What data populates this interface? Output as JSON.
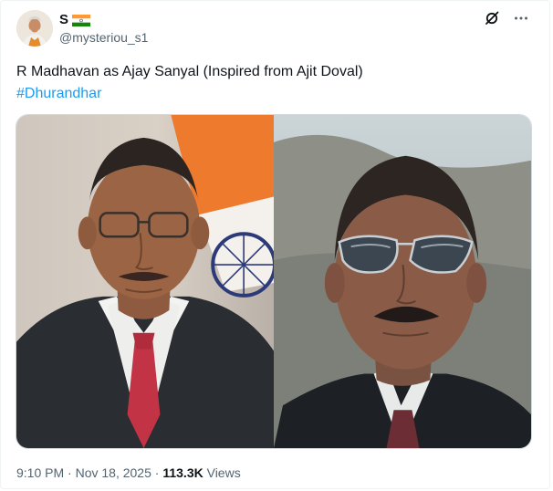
{
  "author": {
    "display_name": "S",
    "handle": "@mysteriou_s1",
    "avatar_icon": "profile-avatar",
    "flag_icon": "india-flag-icon"
  },
  "header_actions": {
    "grok_icon": "slashed-circle-icon",
    "more_icon": "more-horizontal-icon",
    "more_label": "···"
  },
  "tweet": {
    "text": "R Madhavan as Ajay Sanyal (Inspired from Ajit Doval)",
    "hashtag": "#Dhurandhar"
  },
  "media": {
    "left_image": "photo-man-in-suit-with-indian-flag",
    "right_image": "photo-man-in-aviator-sunglasses"
  },
  "meta": {
    "time": "9:10 PM",
    "separator1": " · ",
    "date": "Nov 18, 2025",
    "separator2": " · ",
    "views_count": "113.3K",
    "views_label": " Views"
  },
  "colors": {
    "link": "#1d9bf0",
    "secondary_text": "#536471",
    "primary_text": "#0f1419",
    "border": "#cfd9de"
  }
}
